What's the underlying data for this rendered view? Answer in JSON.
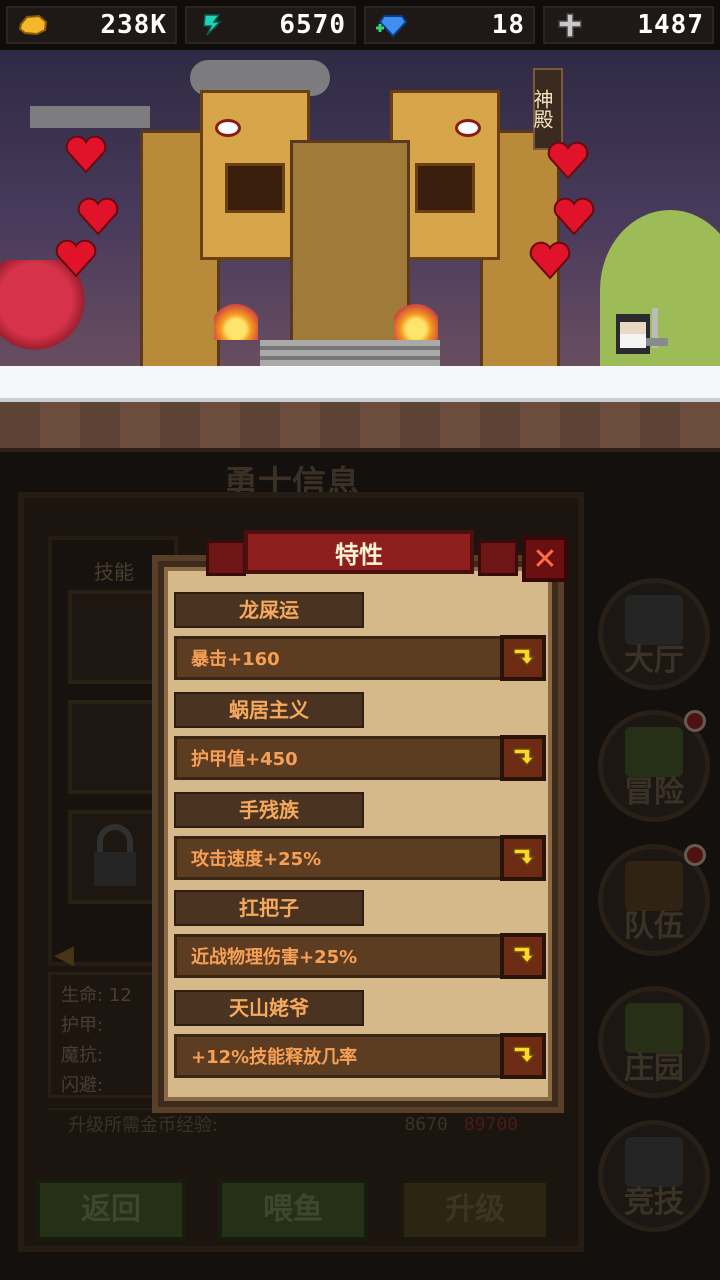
{
  "resources": {
    "gold": "238K",
    "energy": "6570",
    "gems": "18",
    "cross": "1487"
  },
  "scene": {
    "temple_sign": "神殿"
  },
  "panel": {
    "title": "勇士信息",
    "skills_label": "技能",
    "stats": [
      "生命:",
      "护甲:",
      "魔抗:",
      "闪避:"
    ],
    "stat_life_partial": "12",
    "upgrade_req_label": "升级所需金币经验:",
    "upgrade_gold": "8670",
    "upgrade_exp": "89700",
    "buttons": {
      "back": "返回",
      "feed": "喂鱼",
      "upgrade": "升级"
    }
  },
  "nav": [
    {
      "label": "大厅"
    },
    {
      "label": "冒险"
    },
    {
      "label": "队伍"
    },
    {
      "label": "庄园"
    },
    {
      "label": "竞技"
    }
  ],
  "modal": {
    "title": "特性",
    "traits": [
      {
        "name": "龙屎运",
        "effect": "暴击+160"
      },
      {
        "name": "蜗居主义",
        "effect": "护甲值+450"
      },
      {
        "name": "手残族",
        "effect": "攻击速度+25%"
      },
      {
        "name": "扛把子",
        "effect": "近战物理伤害+25%"
      },
      {
        "name": "天山姥爷",
        "effect": "+12%技能释放几率"
      }
    ]
  },
  "colors": {
    "accent_orange": "#f7a055",
    "ribbon_red": "#8e1e1e",
    "parchment": "#d6b98a"
  }
}
